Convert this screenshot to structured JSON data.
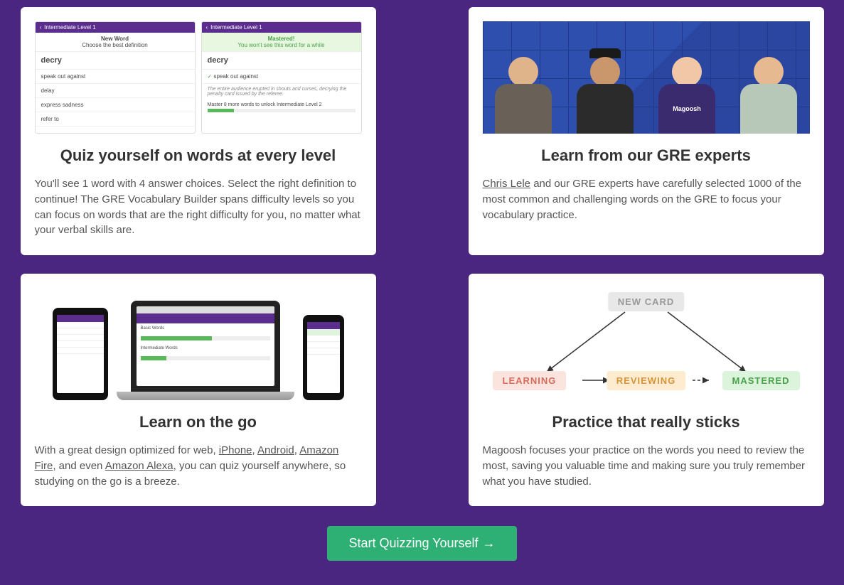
{
  "cards": {
    "quiz": {
      "title": "Quiz yourself on words at every level",
      "body": "You'll see 1 word with 4 answer choices. Select the right definition to continue! The GRE Vocabulary Builder spans difficulty levels so you can focus on words that are the right difficulty for you, no matter what your verbal skills are.",
      "shot_level": "Intermediate Level 1",
      "shot1_heading": "New Word",
      "shot1_sub": "Choose the best definition",
      "shot_word": "decry",
      "shot1_opts": [
        "speak out against",
        "delay",
        "express sadness",
        "refer to"
      ],
      "shot2_heading": "Mastered!",
      "shot2_sub": "You won't see this word for a while",
      "shot2_answer": "speak out against",
      "shot2_hint": "The entire audience erupted in shouts and curses, decrying the penalty card issued by the referee.",
      "shot2_progress": "Master 8 more words to unlock Intermediate Level 2"
    },
    "experts": {
      "title": "Learn from our GRE experts",
      "link_text": "Chris Lele",
      "body_rest": " and our GRE experts have carefully selected 1000 of the most common and challenging words on the GRE to focus your vocabulary practice.",
      "shirt_logo": "Magoosh"
    },
    "go": {
      "title": "Learn on the go",
      "body_1": "With a great design optimized for web, ",
      "link_iphone": "iPhone",
      "sep1": ", ",
      "link_android": "Android",
      "sep2": ", ",
      "link_fire": "Amazon Fire",
      "sep3": ", and even ",
      "link_alexa": "Amazon Alexa",
      "body_2": ", you can quiz yourself anywhere, so studying on the go is a breeze.",
      "laptop_sec1": "Basic Words",
      "laptop_sec2": "Intermediate Words"
    },
    "practice": {
      "title": "Practice that really sticks",
      "body": "Magoosh focuses your practice on the words you need to review the most, saving you valuable time and making sure you truly remember what you have studied.",
      "pill_new": "NEW CARD",
      "pill_learning": "LEARNING",
      "pill_reviewing": "REVIEWING",
      "pill_mastered": "MASTERED"
    }
  },
  "cta": {
    "label": "Start Quizzing Yourself",
    "arrow": "→"
  }
}
